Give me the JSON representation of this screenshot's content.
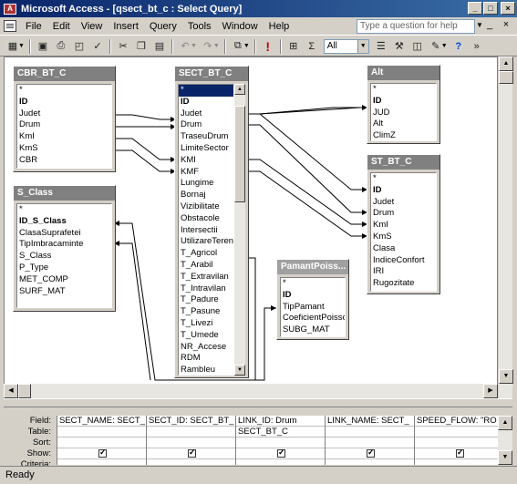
{
  "window": {
    "title": "Microsoft Access - [qsect_bt_c : Select Query]"
  },
  "menu": {
    "items": [
      "File",
      "Edit",
      "View",
      "Insert",
      "Query",
      "Tools",
      "Window",
      "Help"
    ],
    "help_placeholder": "Type a question for help"
  },
  "toolbar": {
    "top_values": "All",
    "sigma": "Σ"
  },
  "tables": [
    {
      "title": "CBR_BT_C",
      "fields": [
        "*",
        "ID",
        "Judet",
        "Drum",
        "KmI",
        "KmS",
        "CBR"
      ],
      "keys": [
        "ID"
      ]
    },
    {
      "title": "SECT_BT_C",
      "fields": [
        "*",
        "ID",
        "Judet",
        "Drum",
        "TraseuDrum",
        "LimiteSector",
        "KMI",
        "KMF",
        "Lungime",
        "Bornaj",
        "Vizibilitate",
        "Obstacole",
        "Intersectii",
        "UtilizareTeren",
        "T_Agricol",
        "T_Arabil",
        "T_Extravilan",
        "T_Intravilan",
        "T_Padure",
        "T_Pasune",
        "T_Livezi",
        "T_Umede",
        "NR_Accese",
        "RDM",
        "Rambleu"
      ],
      "keys": [
        "ID"
      ]
    },
    {
      "title": "Alt",
      "fields": [
        "*",
        "ID",
        "JUD",
        "Alt",
        "ClimZ"
      ],
      "keys": [
        "ID"
      ]
    },
    {
      "title": "ST_BT_C",
      "fields": [
        "*",
        "ID",
        "Judet",
        "Drum",
        "KmI",
        "KmS",
        "Clasa",
        "IndiceConfort",
        "IRI",
        "Rugozitate"
      ],
      "keys": [
        "ID"
      ]
    },
    {
      "title": "S_Class",
      "fields": [
        "*",
        "ID_S_Class",
        "ClasaSuprafetei",
        "TipImbracaminte",
        "S_Class",
        "P_Type",
        "MET_COMP",
        "SURF_MAT"
      ],
      "keys": [
        "ID_S_Class"
      ]
    },
    {
      "title": "PamantPoiss...",
      "fields": [
        "*",
        "ID",
        "TipPamant",
        "CoeficientPoisson",
        "SUBG_MAT"
      ],
      "keys": [
        "ID"
      ]
    }
  ],
  "grid": {
    "row_labels": [
      "Field:",
      "Table:",
      "Sort:",
      "Show:",
      "Criteria:"
    ],
    "columns": [
      {
        "field": "SECT_NAME: SECT_",
        "table": "",
        "sort": "",
        "show": true
      },
      {
        "field": "SECT_ID: SECT_BT_",
        "table": "",
        "sort": "",
        "show": true
      },
      {
        "field": "LINK_ID: Drum",
        "table": "SECT_BT_C",
        "sort": "",
        "show": true
      },
      {
        "field": "LINK_NAME: SECT_",
        "table": "",
        "sort": "",
        "show": true
      },
      {
        "field": "SPEED_FLOW: \"RO",
        "table": "",
        "sort": "",
        "show": true
      }
    ]
  },
  "status": {
    "text": "Ready"
  }
}
